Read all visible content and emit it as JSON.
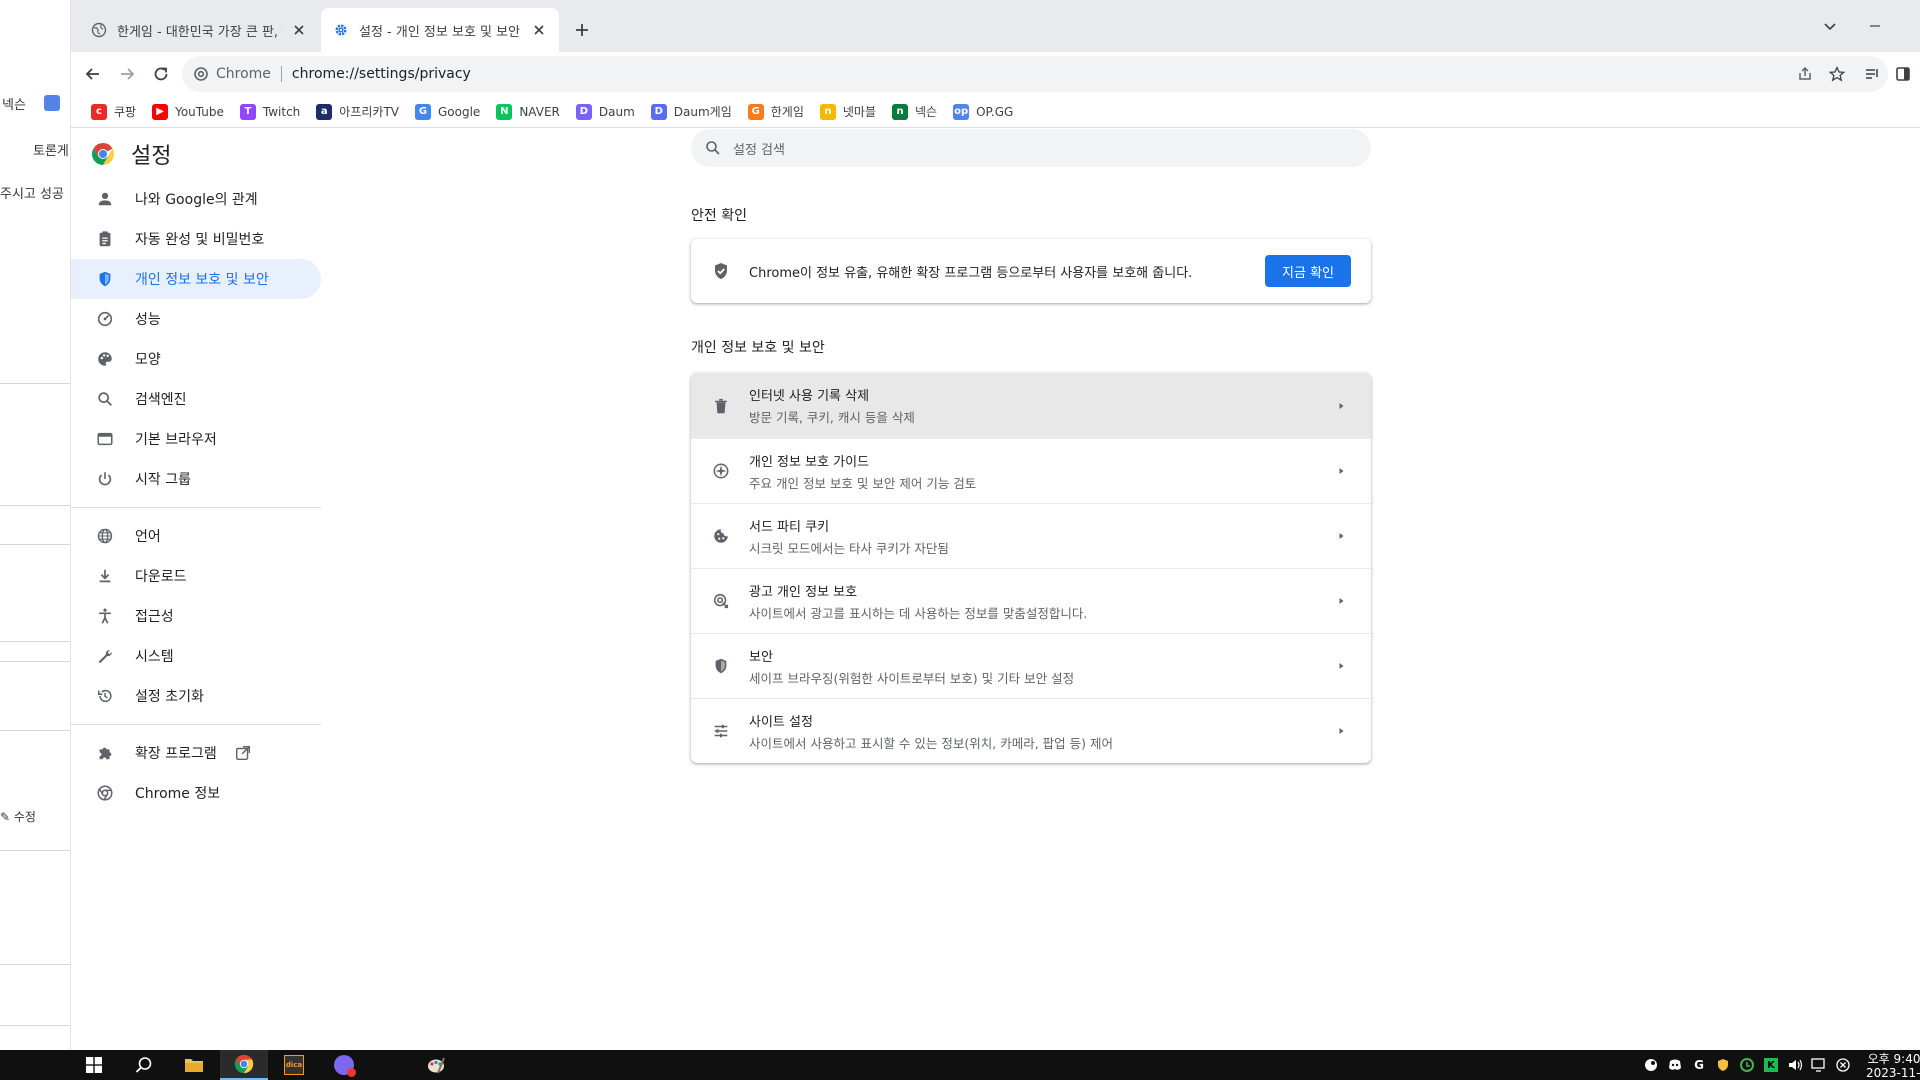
{
  "background_window": {
    "texts": [
      "넥슨",
      "토론게",
      "주시고 성공",
      "수정"
    ]
  },
  "tabs": [
    {
      "title": "한게임 - 대한민국 가장 큰 판, 한",
      "active": false,
      "icon": "globe-icon"
    },
    {
      "title": "설정 - 개인 정보 보호 및 보안",
      "active": true,
      "icon": "gear-icon"
    }
  ],
  "omnibox": {
    "chip": "Chrome",
    "url": "chrome://settings/privacy"
  },
  "bookmarks": [
    {
      "label": "쿠팡",
      "color": "#e52d27",
      "glyph": "c"
    },
    {
      "label": "YouTube",
      "color": "#ff0000",
      "glyph": "▶"
    },
    {
      "label": "Twitch",
      "color": "#9146ff",
      "glyph": "T"
    },
    {
      "label": "아프리카TV",
      "color": "#1d2d6b",
      "glyph": "a"
    },
    {
      "label": "Google",
      "color": "#4285f4",
      "glyph": "G"
    },
    {
      "label": "NAVER",
      "color": "#03c75a",
      "glyph": "N"
    },
    {
      "label": "Daum",
      "color": "#7b61ff",
      "glyph": "D"
    },
    {
      "label": "Daum게임",
      "color": "#5a6cf0",
      "glyph": "D"
    },
    {
      "label": "한게임",
      "color": "#f47b20",
      "glyph": "G"
    },
    {
      "label": "넷마블",
      "color": "#f5b800",
      "glyph": "n"
    },
    {
      "label": "넥슨",
      "color": "#0a7b3e",
      "glyph": "n"
    },
    {
      "label": "OP.GG",
      "color": "#5383e8",
      "glyph": "op"
    }
  ],
  "sidebar": {
    "title": "설정",
    "items": [
      {
        "label": "나와 Google의 관계",
        "icon": "person-icon"
      },
      {
        "label": "자동 완성 및 비밀번호",
        "icon": "clipboard-icon"
      },
      {
        "label": "개인 정보 보호 및 보안",
        "icon": "shield-icon",
        "selected": true
      },
      {
        "label": "성능",
        "icon": "speedometer-icon"
      },
      {
        "label": "모양",
        "icon": "palette-icon"
      },
      {
        "label": "검색엔진",
        "icon": "search-icon"
      },
      {
        "label": "기본 브라우저",
        "icon": "browser-icon"
      },
      {
        "label": "시작 그룹",
        "icon": "power-icon"
      },
      {
        "label": "언어",
        "icon": "globe-icon"
      },
      {
        "label": "다운로드",
        "icon": "download-icon"
      },
      {
        "label": "접근성",
        "icon": "accessibility-icon"
      },
      {
        "label": "시스템",
        "icon": "wrench-icon"
      },
      {
        "label": "설정 초기화",
        "icon": "history-icon"
      },
      {
        "label": "확장 프로그램",
        "icon": "puzzle-icon"
      },
      {
        "label": "Chrome 정보",
        "icon": "chrome-icon"
      }
    ]
  },
  "main": {
    "search_placeholder": "설정 검색",
    "safety_title": "안전 확인",
    "safety_text": "Chrome이 정보 유출, 유해한 확장 프로그램 등으로부터 사용자를 보호해 줍니다.",
    "safety_button": "지금 확인",
    "privacy_title": "개인 정보 보호 및 보안",
    "rows": [
      {
        "title": "인터넷 사용 기록 삭제",
        "sub": "방문 기록, 쿠키, 캐시 등을 삭제",
        "icon": "trash-icon"
      },
      {
        "title": "개인 정보 보호 가이드",
        "sub": "주요 개인 정보 보호 및 보안 제어 기능 검토",
        "icon": "compass-icon"
      },
      {
        "title": "서드 파티 쿠키",
        "sub": "시크릿 모드에서는 타사 쿠키가 자단됨",
        "icon": "cookie-icon"
      },
      {
        "title": "광고 개인 정보 보호",
        "sub": "사이트에서 광고를 표시하는 데 사용하는 정보를 맞춤설정합니다.",
        "icon": "ad-privacy-icon"
      },
      {
        "title": "보안",
        "sub": "세이프 브라우징(위험한 사이트로부터 보호) 및 기타 보안 설정",
        "icon": "shield-icon"
      },
      {
        "title": "사이트 설정",
        "sub": "사이트에서 사용하고 표시할 수 있는 정보(위치, 카메라, 팝업 등) 제어",
        "icon": "tune-icon"
      }
    ]
  },
  "taskbar": {
    "clock_time": "오후 9:40",
    "clock_date": "2023-11-"
  },
  "colors": {
    "accent": "#1a73e8",
    "selected_bg": "#e8f0fe",
    "tabstrip_bg": "#e8eaed",
    "taskbar_bg": "#101010"
  }
}
